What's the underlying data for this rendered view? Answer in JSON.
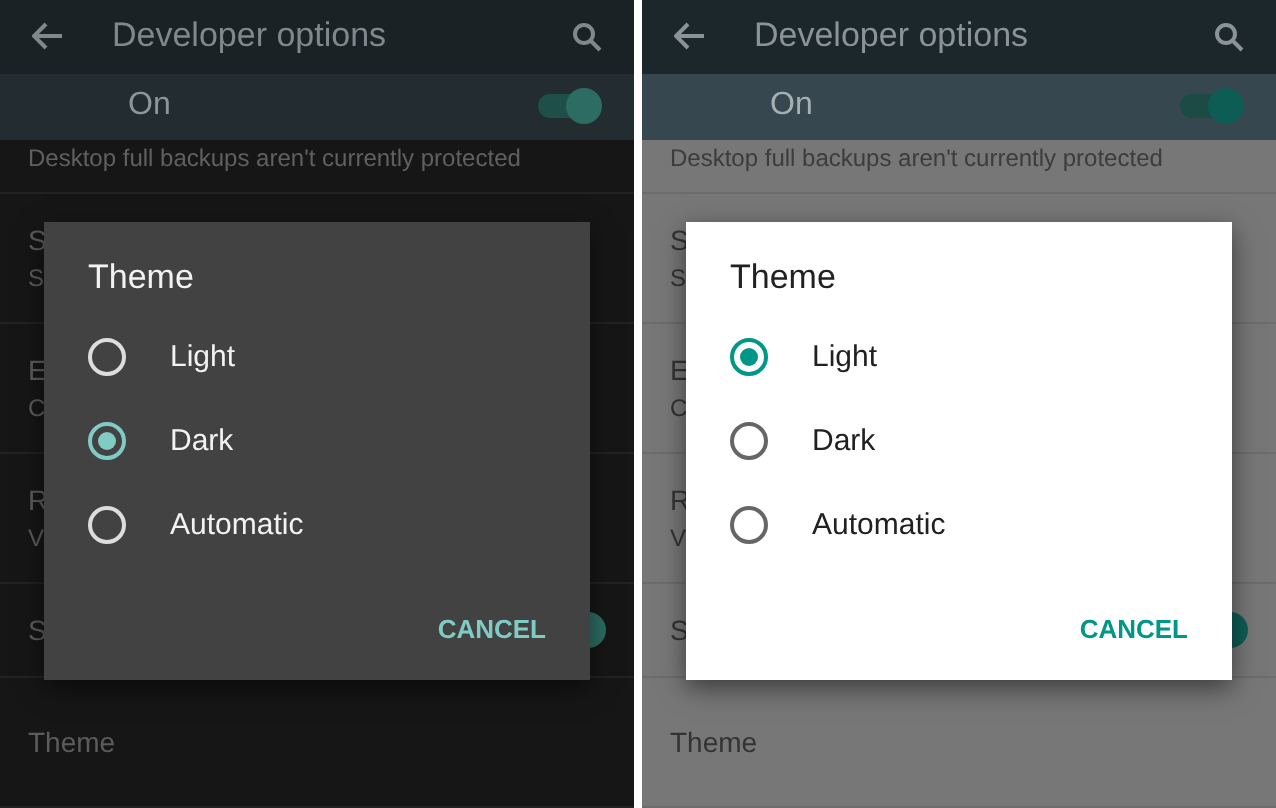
{
  "screens": [
    {
      "kind": "dark",
      "app_bar": {
        "title": "Developer options"
      },
      "master_switch": {
        "label": "On",
        "on": true
      },
      "notice": "Desktop full backups aren't currently protected",
      "rows": [
        {
          "title": "S",
          "subtitle": "S"
        },
        {
          "title": "E",
          "subtitle": "C"
        },
        {
          "title": "R",
          "subtitle": "V"
        },
        {
          "title": "S",
          "switch_on": true
        },
        {
          "title": "Theme"
        }
      ],
      "dialog": {
        "title": "Theme",
        "options": [
          {
            "label": "Light",
            "selected": false
          },
          {
            "label": "Dark",
            "selected": true
          },
          {
            "label": "Automatic",
            "selected": false
          }
        ],
        "buttons": [
          "CANCEL"
        ]
      }
    },
    {
      "kind": "light",
      "app_bar": {
        "title": "Developer options"
      },
      "master_switch": {
        "label": "On",
        "on": true
      },
      "notice": "Desktop full backups aren't currently protected",
      "rows": [
        {
          "title": "S",
          "subtitle": "S"
        },
        {
          "title": "E",
          "subtitle": "C"
        },
        {
          "title": "R",
          "subtitle": "V"
        },
        {
          "title": "S",
          "switch_on": true
        },
        {
          "title": "Theme"
        }
      ],
      "dialog": {
        "title": "Theme",
        "options": [
          {
            "label": "Light",
            "selected": true
          },
          {
            "label": "Dark",
            "selected": false
          },
          {
            "label": "Automatic",
            "selected": false
          }
        ],
        "buttons": [
          "CANCEL"
        ]
      }
    }
  ]
}
